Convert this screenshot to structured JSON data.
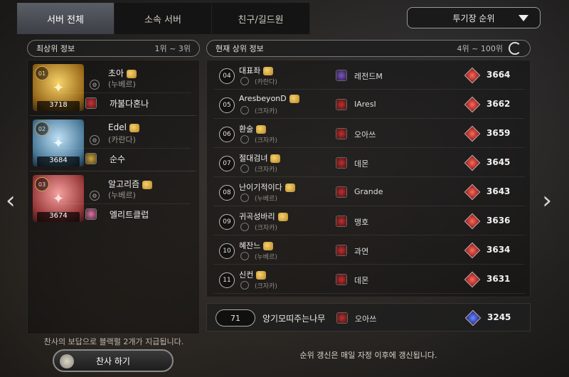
{
  "tabs": [
    {
      "label": "서버 전체",
      "active": true
    },
    {
      "label": "소속 서버",
      "active": false
    },
    {
      "label": "친구/길드원",
      "active": false
    }
  ],
  "ranking_dropdown": {
    "label": "투기장 순위"
  },
  "left_header": {
    "title": "최상위 정보",
    "range": "1위 ~ 3위"
  },
  "right_header": {
    "title": "현재 상위 정보",
    "range": "4위 ~ 100위"
  },
  "top_players": [
    {
      "rank": "01",
      "score": "3718",
      "name": "초아",
      "server": "(누베르)",
      "guild": "까불다혼나",
      "color": "gold"
    },
    {
      "rank": "02",
      "score": "3684",
      "name": "Edel",
      "server": "(카란다)",
      "guild": "순수",
      "color": "blue"
    },
    {
      "rank": "03",
      "score": "3674",
      "name": "알고리즘",
      "server": "(누베르)",
      "guild": "엘리트클럽",
      "color": "pink"
    }
  ],
  "rank_list": [
    {
      "rank": "04",
      "name": "대표좌",
      "server": "(카란다)",
      "guild": "레전드M",
      "score": "3664"
    },
    {
      "rank": "05",
      "name": "AresbeyonD",
      "server": "(크자카)",
      "guild": "IAresI",
      "score": "3662"
    },
    {
      "rank": "06",
      "name": "환술",
      "server": "(크자카)",
      "guild": "오아쓰",
      "score": "3659"
    },
    {
      "rank": "07",
      "name": "절대검녀",
      "server": "(크자카)",
      "guild": "데몬",
      "score": "3645"
    },
    {
      "rank": "08",
      "name": "난이기적이다",
      "server": "(누베르)",
      "guild": "Grande",
      "score": "3643"
    },
    {
      "rank": "09",
      "name": "귀곡성바리",
      "server": "(크자카)",
      "guild": "맹호",
      "score": "3636"
    },
    {
      "rank": "10",
      "name": "혜잔느",
      "server": "(누베르)",
      "guild": "과연",
      "score": "3634"
    },
    {
      "rank": "11",
      "name": "신컨",
      "server": "(크자카)",
      "guild": "데몬",
      "score": "3631"
    }
  ],
  "my_rank": {
    "rank": "71",
    "name": "앙기모띠주는나무",
    "guild": "오아쓰",
    "score": "3245"
  },
  "notice_left": "찬사의 보답으로 블랙펄 2개가 지급됩니다.",
  "tribute_button": "찬사 하기",
  "notice_right": "순위 갱신은 매일 자정 이후에 갱신됩니다.",
  "nav": {
    "prev": "‹",
    "next": "›"
  }
}
